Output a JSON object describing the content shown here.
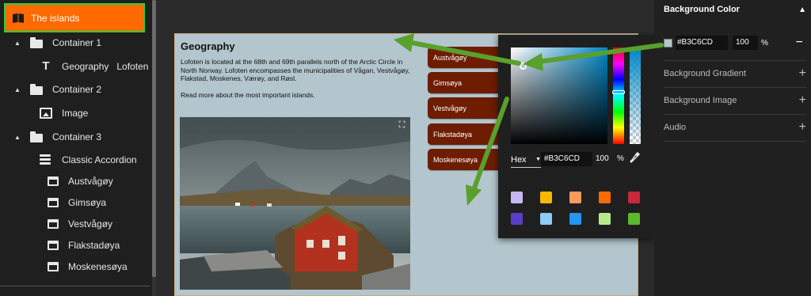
{
  "sidebar": {
    "root": {
      "label": "The islands",
      "icon": "book-icon"
    },
    "items": [
      {
        "label": "Container 1",
        "icon": "folder-icon"
      },
      {
        "label": "Geography   Lofoten",
        "icon": "text-icon"
      },
      {
        "label": "Container 2",
        "icon": "folder-icon"
      },
      {
        "label": "Image",
        "icon": "image-icon"
      },
      {
        "label": "Container 3",
        "icon": "folder-icon"
      },
      {
        "label": "Classic Accordion",
        "icon": "accordion-icon"
      },
      {
        "label": "Austvågøy",
        "icon": "window-icon"
      },
      {
        "label": "Gimsøya",
        "icon": "window-icon"
      },
      {
        "label": "Vestvågøy",
        "icon": "window-icon"
      },
      {
        "label": "Flakstadøya",
        "icon": "window-icon"
      },
      {
        "label": "Moskenesøya",
        "icon": "window-icon"
      }
    ]
  },
  "canvas": {
    "background": "#B3C6CD",
    "title": "Geography",
    "paragraph1": "Lofoten is located at the 68th and 69th parallels north of the Arctic Circle in North Norway. Lofoten encompasses the municipalities of Vågan, Vestvågøy, Flakstad, Moskenes, Værøy, and Røst.",
    "paragraph2": "Read more about the most important islands.",
    "accordion": [
      "Austvågøy",
      "Gimsøya",
      "Vestvågøy",
      "Flakstadøya",
      "Moskenesøya"
    ]
  },
  "picker": {
    "mode": "Hex",
    "hex": "#B3C6CD",
    "opacity": "100",
    "percent": "%",
    "swatches": [
      "#c8b8f0",
      "#f5b800",
      "#ff9a5c",
      "#ff6a00",
      "#c8283c",
      "#5a3ec8",
      "#8ecbf5",
      "#2196f3",
      "#b7e88a",
      "#5cb82e"
    ]
  },
  "right_panel": {
    "bg_color_title": "Background Color",
    "hex": "#B3C6CD",
    "opacity": "100",
    "percent": "%",
    "sections": [
      "Background Gradient",
      "Background Image",
      "Audio"
    ]
  }
}
